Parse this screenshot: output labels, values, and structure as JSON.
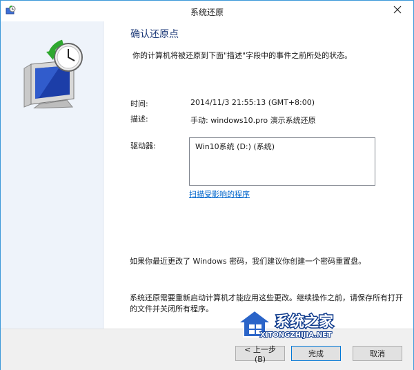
{
  "window": {
    "title": "系统还原"
  },
  "main": {
    "heading": "确认还原点",
    "description": "你的计算机将被还原到下面\"描述\"字段中的事件之前所处的状态。",
    "time_label": "时间:",
    "time_value": "2014/11/3 21:55:13 (GMT+8:00)",
    "desc_label": "描述:",
    "desc_value": "手动: windows10.pro 演示系统还原",
    "drive_label": "驱动器:",
    "drives": [
      "Win10系统 (D:) (系统)"
    ],
    "scan_link": "扫描受影响的程序",
    "password_note": "如果你最近更改了 Windows 密码，我们建议你创建一个密码重置盘。",
    "restart_note": "系统还原需要重新启动计算机才能应用这些更改。继续操作之前，请保存所有打开的文件并关闭所有程序。"
  },
  "footer": {
    "back_label": "< 上一步(B)",
    "finish_label": "完成",
    "cancel_label": "取消"
  },
  "watermark": {
    "brand": "系统之家",
    "url": "XITONGZHIJIA.NET"
  },
  "colors": {
    "accent": "#0078d7",
    "heading": "#1d3a78",
    "link": "#0066cc",
    "sidebar": "#eef3fa"
  },
  "icons": [
    "system-restore-icon",
    "close-icon",
    "computer-restore-icon",
    "house-logo-icon"
  ]
}
